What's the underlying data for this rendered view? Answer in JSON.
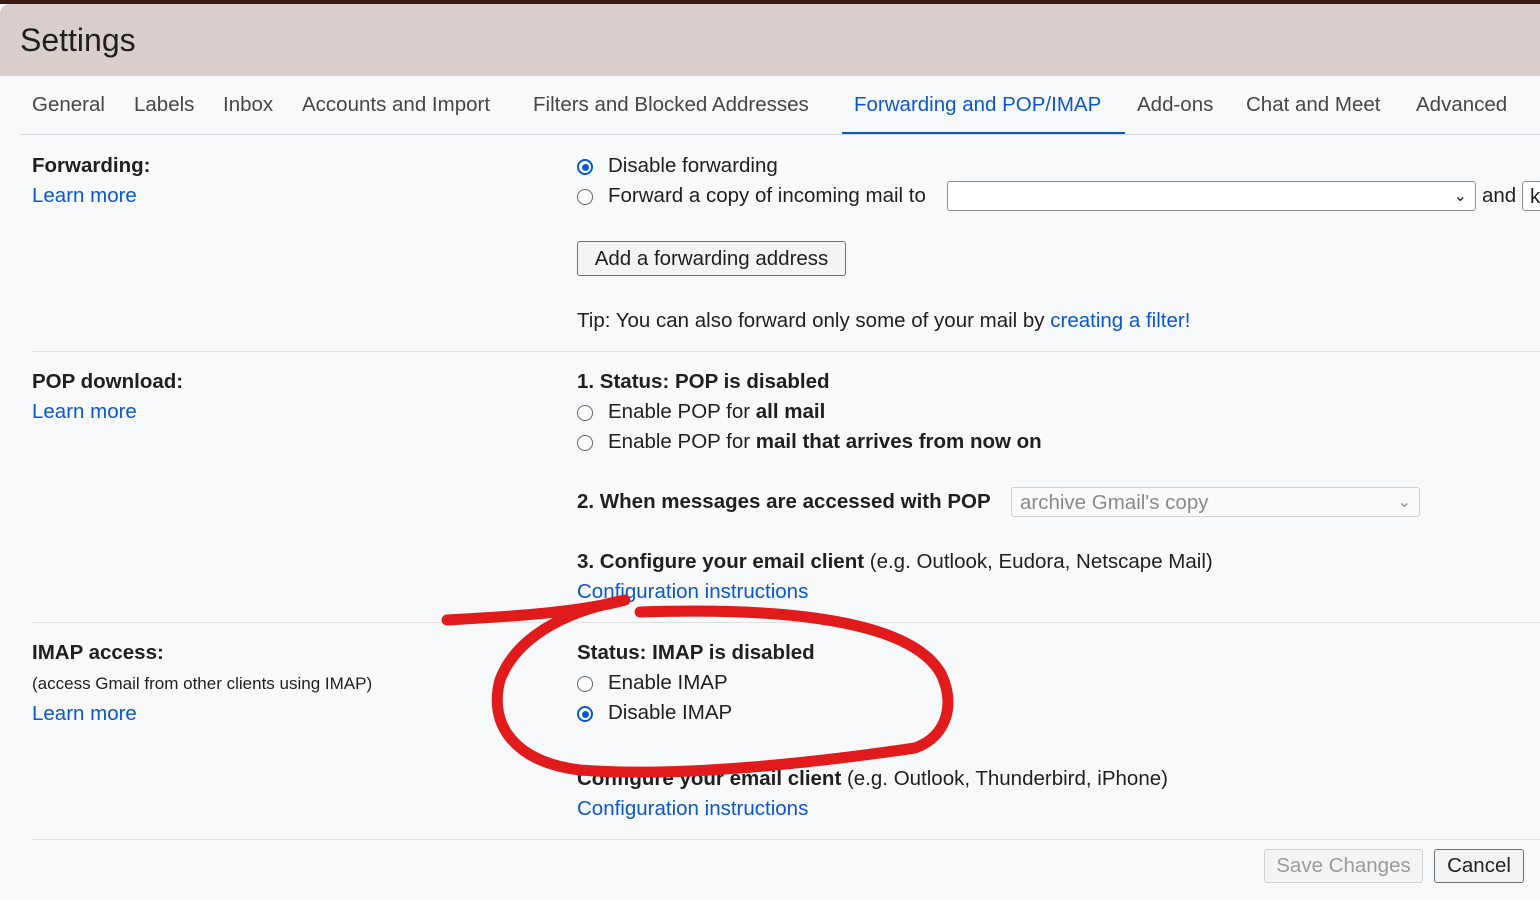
{
  "header": {
    "title": "Settings"
  },
  "tabs": [
    "General",
    "Labels",
    "Inbox",
    "Accounts and Import",
    "Filters and Blocked Addresses",
    "Forwarding and POP/IMAP",
    "Add-ons",
    "Chat and Meet",
    "Advanced"
  ],
  "active_tab": "Forwarding and POP/IMAP",
  "forwarding": {
    "label": "Forwarding:",
    "learn_more": "Learn more",
    "option_disable": "Disable forwarding",
    "option_forward": "Forward a copy of incoming mail to",
    "forward_and": "and",
    "forward_second_select_value": "k",
    "add_button": "Add a forwarding address",
    "tip_prefix": "Tip: You can also forward only some of your mail by ",
    "tip_link": "creating a filter!",
    "selected": "disable"
  },
  "pop": {
    "label": "POP download:",
    "learn_more": "Learn more",
    "status": "1. Status: POP is disabled",
    "opt_all_prefix": "Enable POP for ",
    "opt_all_bold": "all mail",
    "opt_now_prefix": "Enable POP for ",
    "opt_now_bold": "mail that arrives from now on",
    "when_label": "2. When messages are accessed with POP",
    "when_value": "archive Gmail's copy",
    "configure_bold": "3. Configure your email client",
    "configure_rest": " (e.g. Outlook, Eudora, Netscape Mail)",
    "config_link": "Configuration instructions"
  },
  "imap": {
    "label": "IMAP access:",
    "sublabel": "(access Gmail from other clients using IMAP)",
    "learn_more": "Learn more",
    "status": "Status: IMAP is disabled",
    "opt_enable": "Enable IMAP",
    "opt_disable": "Disable IMAP",
    "selected": "disable",
    "configure_bold": "Configure your email client",
    "configure_rest": " (e.g. Outlook, Thunderbird, iPhone)",
    "config_link": "Configuration instructions"
  },
  "footer": {
    "save": "Save Changes",
    "cancel": "Cancel"
  },
  "colors": {
    "accent": "#0b57d0",
    "annotation": "#e11b1b",
    "header_bg": "#d8cfcc"
  }
}
